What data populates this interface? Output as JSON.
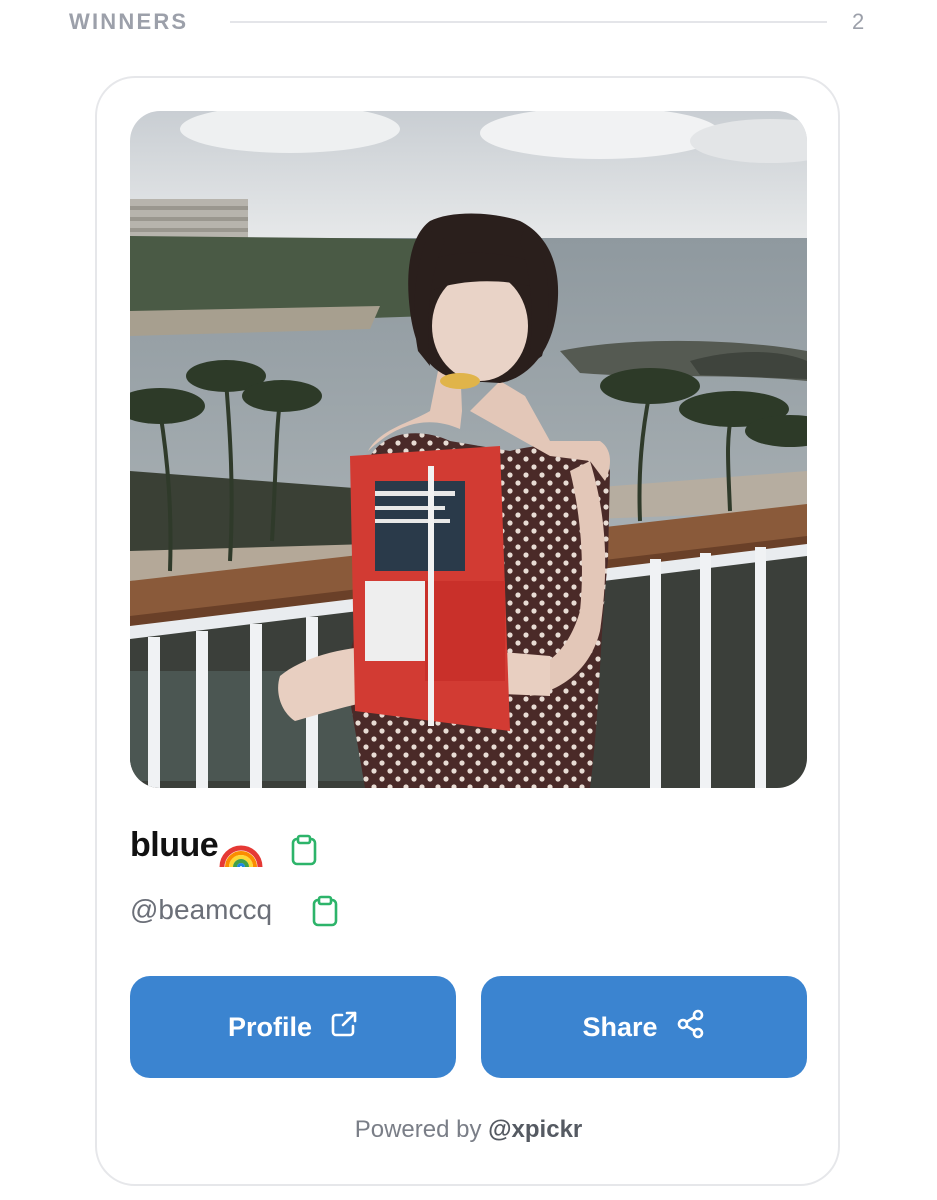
{
  "header": {
    "title": "WINNERS",
    "count": "2"
  },
  "winner": {
    "display_name": "bluue",
    "emoji_icon": "rainbow-emoji",
    "handle": "@beamccq"
  },
  "actions": {
    "profile_label": "Profile",
    "profile_icon": "external-link-icon",
    "share_label": "Share",
    "share_icon": "share-icon"
  },
  "footer": {
    "prefix": "Powered by",
    "brand": "@xpickr"
  },
  "colors": {
    "button": "#3b84d0",
    "copy_icon": "#2db46a",
    "muted": "#9ca0aa"
  }
}
